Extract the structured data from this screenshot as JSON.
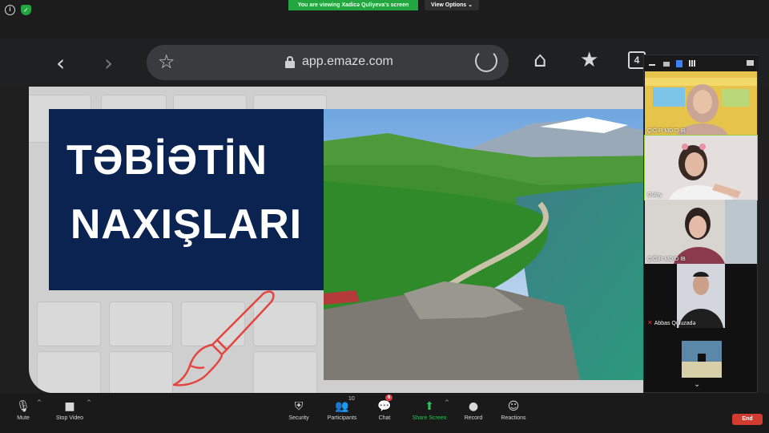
{
  "topbar": {
    "banner_text": "You are viewing Xadicə Quliyeva's screen",
    "view_options_label": "View Options ⌄",
    "info_icon": "i",
    "shield_icon": "✓"
  },
  "browser": {
    "url": "app.emaze.com",
    "back_icon": "‹",
    "forward_icon": "›",
    "star_icon": "☆",
    "home_icon": "⌂",
    "bookmark_icon": "★",
    "tabs_count": "4"
  },
  "slide": {
    "title_line_1": "TƏBİƏTİN",
    "title_line_2": "NAXIŞLARI",
    "title_box_color": "#0b2350",
    "brush_color": "#e2463f"
  },
  "participants": [
    {
      "name": "ÇIĞIR MDID İB",
      "muted": false
    },
    {
      "name": "Gülay",
      "muted": false
    },
    {
      "name": "ÇIĞIR MDID İB",
      "muted": false
    },
    {
      "name": "Abbas Quluzadə",
      "muted": true
    },
    {
      "name": "",
      "muted": false
    }
  ],
  "panel": {
    "scroll_icon": "⌄"
  },
  "toolbar": {
    "mute_label": "Mute",
    "stop_video_label": "Stop Video",
    "security_label": "Security",
    "participants_label": "Participants",
    "participants_count": "10",
    "chat_label": "Chat",
    "chat_badge": "6",
    "share_screen_label": "Share Screen",
    "record_label": "Record",
    "reactions_label": "Reactions",
    "end_label": "End",
    "mute_icon": "🎙",
    "video_icon": "■",
    "security_icon": "⛨",
    "participants_icon": "👥",
    "chat_icon": "💬",
    "share_icon": "⬆",
    "record_icon": "●",
    "reactions_icon": "☺",
    "caret_icon": "^"
  },
  "colors": {
    "share_green": "#23a640",
    "end_red": "#d23b30",
    "speaker_outline": "#9acb3c"
  }
}
